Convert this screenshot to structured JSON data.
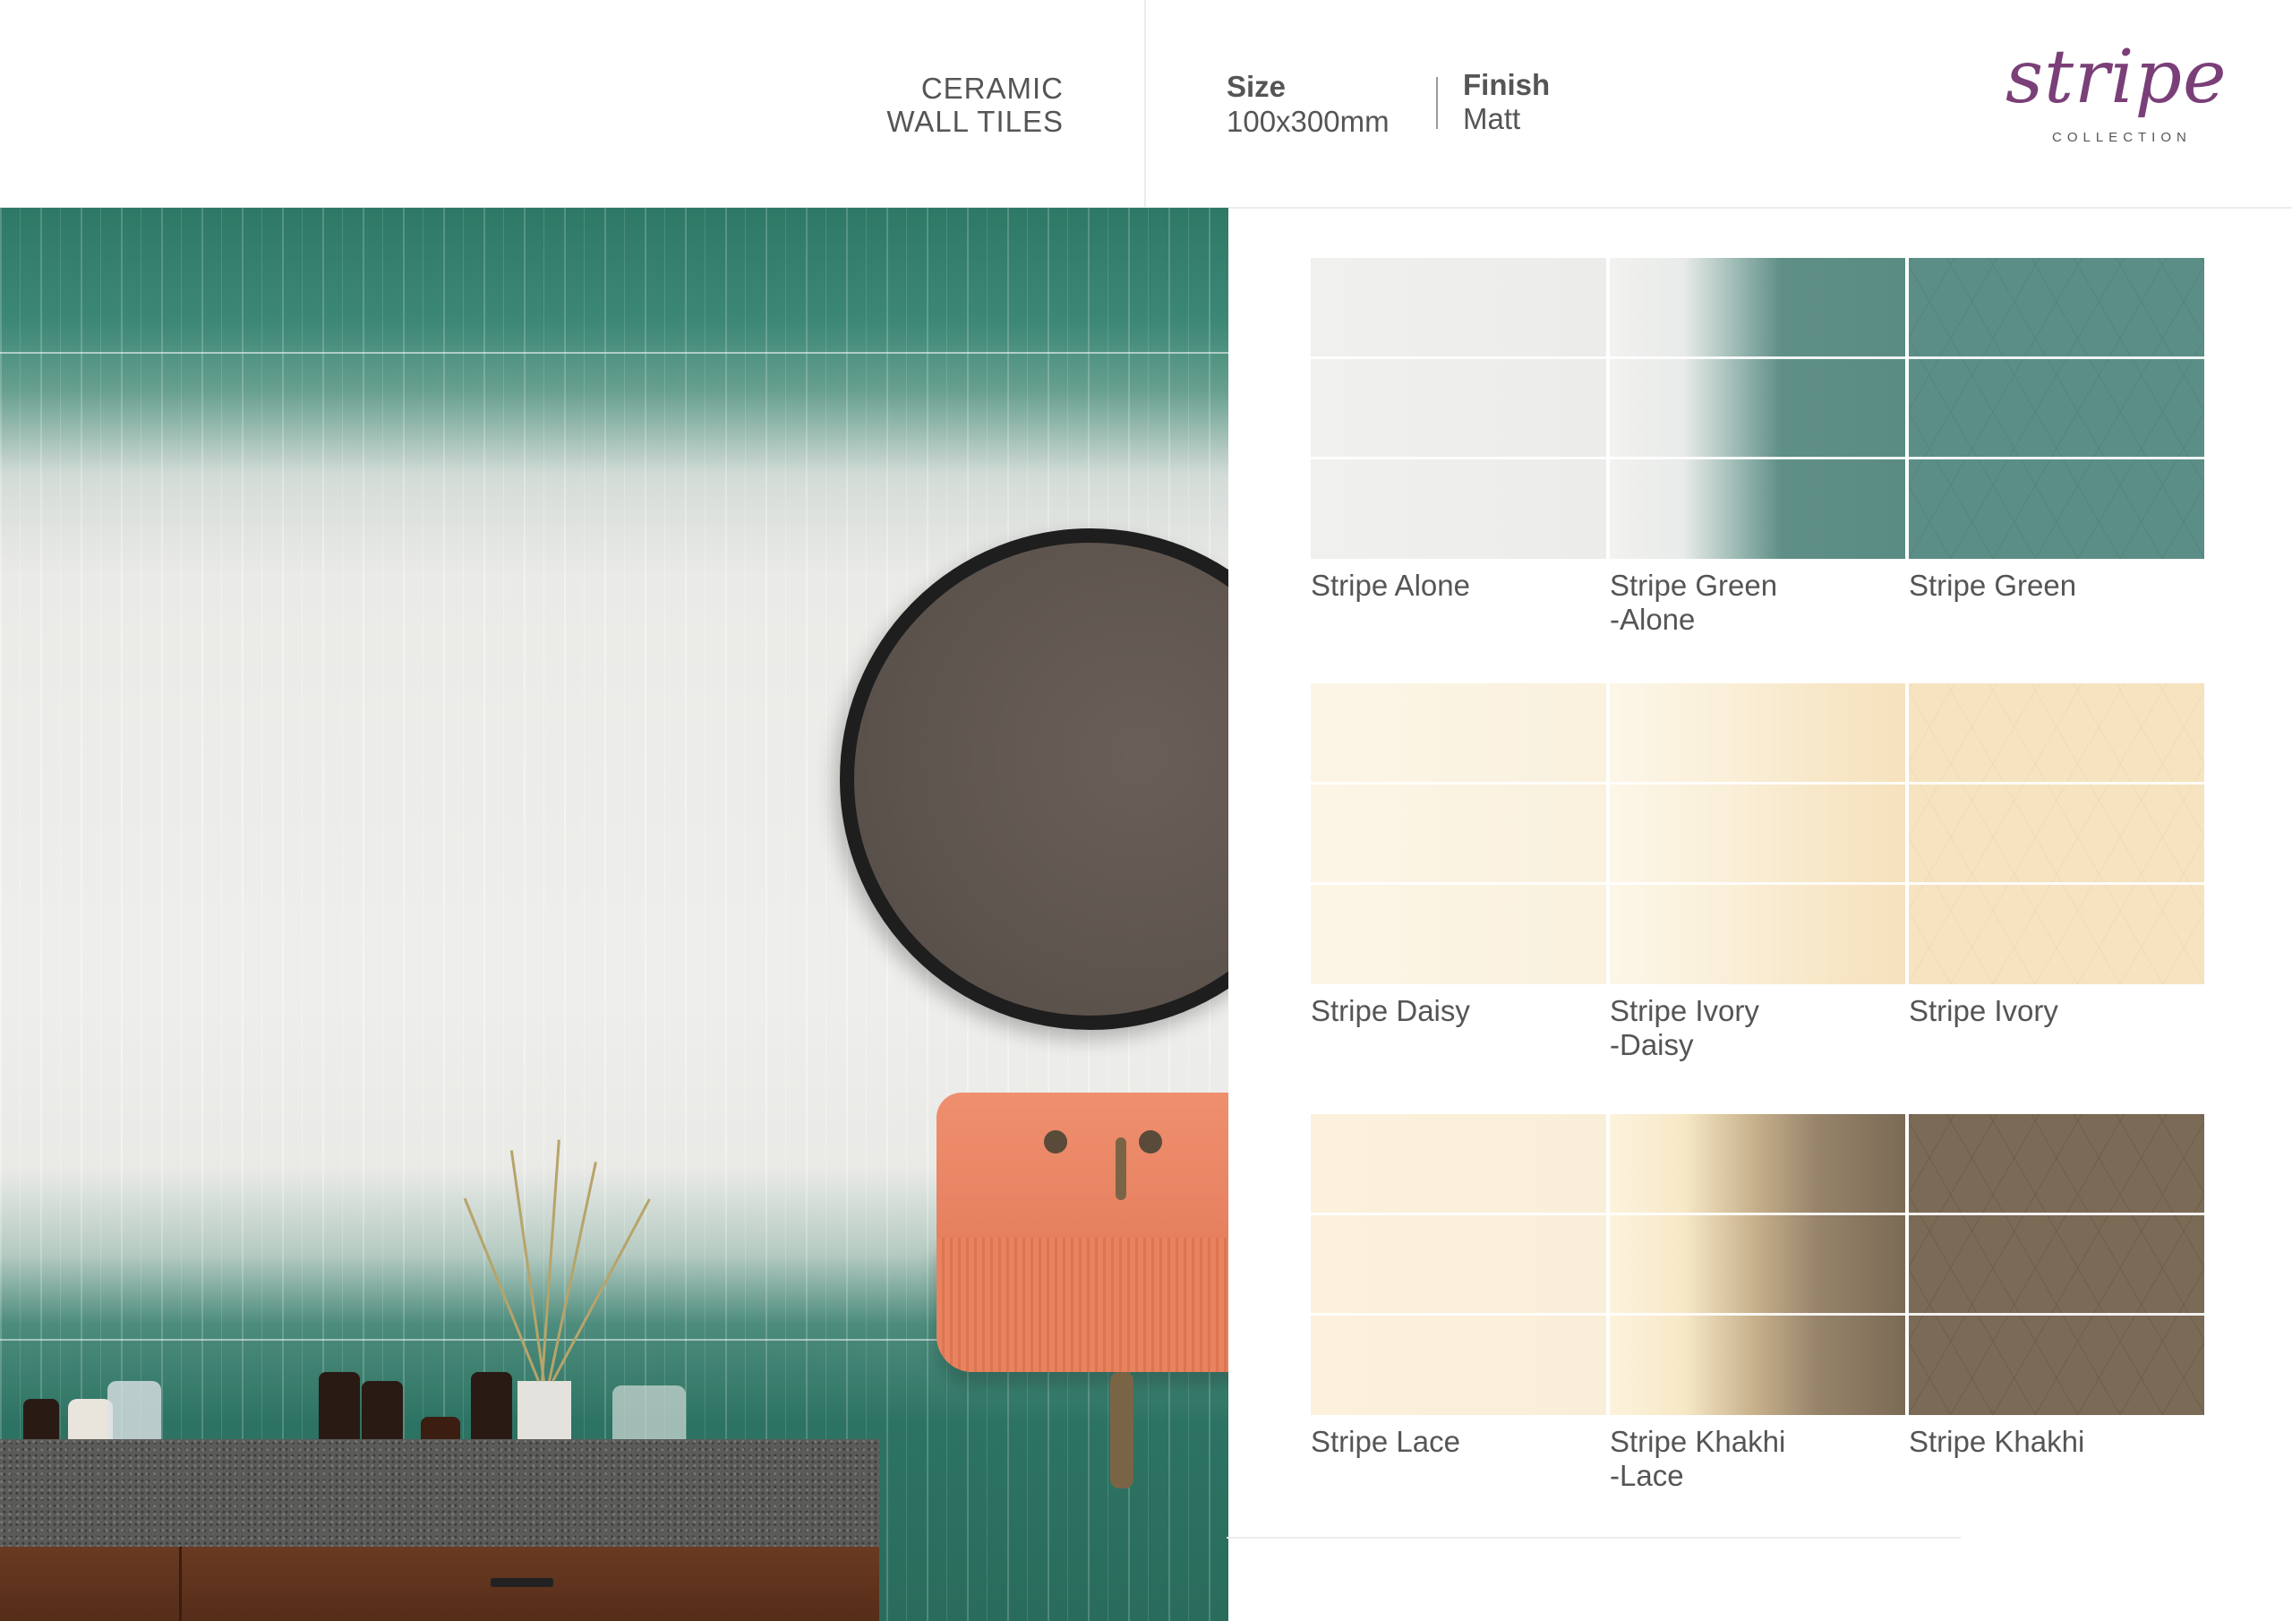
{
  "header": {
    "type_line1": "CERAMIC",
    "type_line2": "WALL TILES",
    "size_label": "Size",
    "size_value": "100x300mm",
    "finish_label": "Finish",
    "finish_value": "Matt",
    "logo_word": "stripe",
    "logo_sub": "COLLECTION"
  },
  "colors": {
    "brand": "#7a3f78",
    "green": "#5a8c84",
    "ivory": "#f6e6c4",
    "khaki": "#7b6a55",
    "alone": "#eeeeec"
  },
  "swatch_rows": [
    {
      "items": [
        {
          "name": "Stripe Alone",
          "name2": ""
        },
        {
          "name": "Stripe Green",
          "name2": "-Alone"
        },
        {
          "name": "Stripe Green",
          "name2": ""
        }
      ]
    },
    {
      "items": [
        {
          "name": "Stripe Daisy",
          "name2": ""
        },
        {
          "name": "Stripe Ivory",
          "name2": "-Daisy"
        },
        {
          "name": "Stripe Ivory",
          "name2": ""
        }
      ]
    },
    {
      "items": [
        {
          "name": "Stripe Lace",
          "name2": ""
        },
        {
          "name": "Stripe Khakhi",
          "name2": "-Lace"
        },
        {
          "name": "Stripe Khakhi",
          "name2": ""
        }
      ]
    }
  ]
}
